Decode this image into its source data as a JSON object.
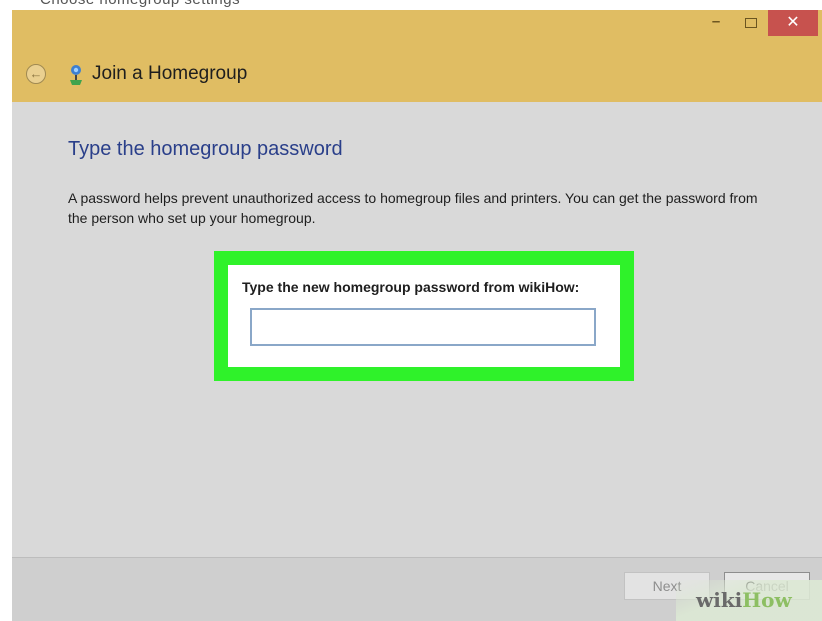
{
  "top_cut_text": "Choose homegroup settings",
  "window": {
    "controls": {
      "minimize_glyph": "–",
      "close_glyph": "✕"
    },
    "back_glyph": "←",
    "title": "Join a Homegroup",
    "title_icon": "homegroup-icon",
    "accent_color": "#e0bd63",
    "close_color": "#c7524e"
  },
  "main": {
    "heading": "Type the homegroup password",
    "description": "A password helps prevent unauthorized access to homegroup files and printers. You can get the password from the person who set up your homegroup.",
    "highlight_color": "#2ff22a",
    "password_label": "Type the new homegroup password from wikiHow:",
    "password_value": "",
    "password_placeholder": ""
  },
  "footer": {
    "next_label": "Next",
    "cancel_label": "Cancel"
  },
  "watermark": {
    "part1": "wiki",
    "part2": "How"
  }
}
